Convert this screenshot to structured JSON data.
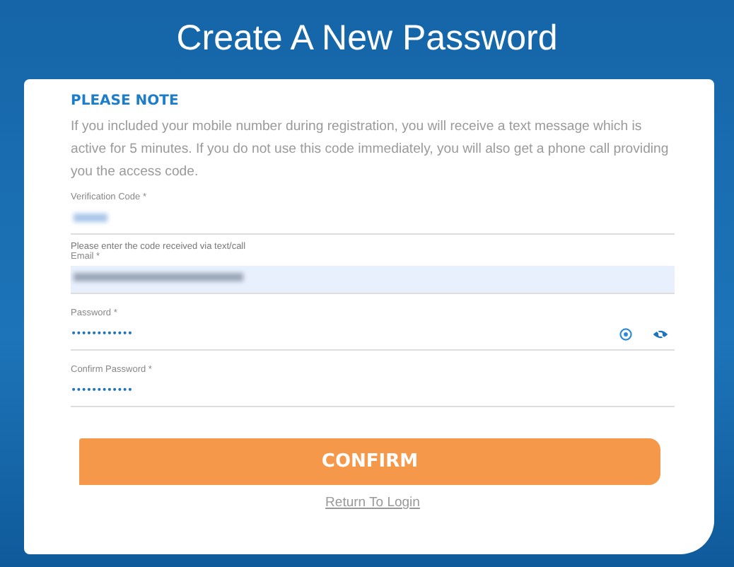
{
  "title": "Create A New Password",
  "note": {
    "heading": "PLEASE NOTE",
    "text": "If you included your mobile number during registration, you will receive a text message which is active for 5 minutes. If you do not use this code immediately, you will also get a phone call providing you the access code."
  },
  "fields": [
    {
      "kind": "redacted",
      "label": "Verification Code *",
      "hint": "Please enter the code received via text/call",
      "filled": false
    },
    {
      "kind": "redacted",
      "label": "Email *",
      "filled": true
    },
    {
      "kind": "password",
      "label": "Password *",
      "value": "••••••••••••",
      "help": true,
      "toggle": true
    },
    {
      "kind": "password",
      "label": "Confirm Password *",
      "value": "••••••••••••"
    }
  ],
  "confirm_button": "CONFIRM",
  "return_link": "Return To Login"
}
